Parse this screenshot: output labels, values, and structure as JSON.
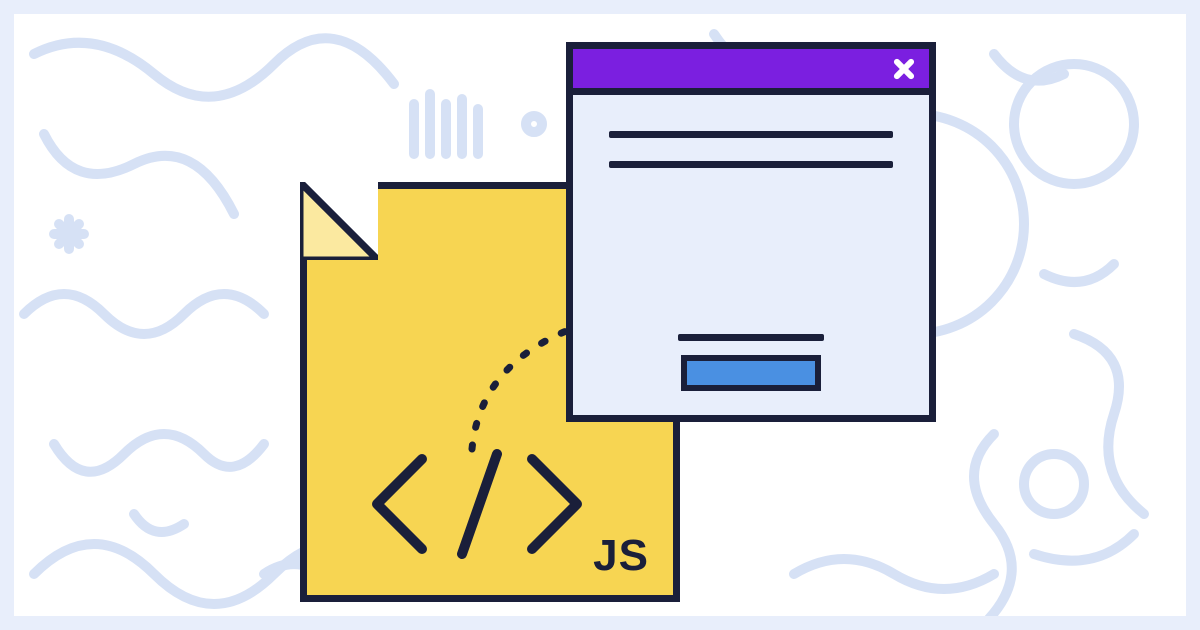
{
  "file": {
    "extension_label": "JS",
    "icon": "code-tag-icon"
  },
  "window": {
    "titlebar_color": "#7b1fe0",
    "close_icon": "close-icon",
    "button_color": "#4a90e2"
  },
  "palette": {
    "stroke": "#1a1f3a",
    "file_fill": "#f7d552",
    "window_fill": "#e8eefb",
    "doodle": "#d6e1f5"
  }
}
